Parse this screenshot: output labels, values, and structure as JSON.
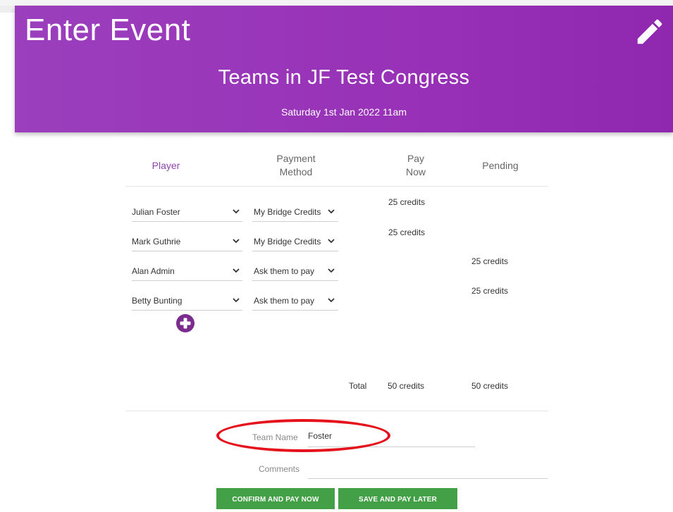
{
  "header": {
    "title": "Enter Event",
    "event_name": "Teams in JF Test Congress",
    "event_date": "Saturday 1st Jan 2022 11am",
    "edit_icon": "pencil-icon"
  },
  "table": {
    "headers": {
      "player": "Player",
      "payment_method_line1": "Payment",
      "payment_method_line2": "Method",
      "pay_now_line1": "Pay",
      "pay_now_line2": "Now",
      "pending": "Pending"
    },
    "rows": [
      {
        "player": "Julian Foster",
        "method": "My Bridge Credits",
        "pay_now": "25 credits",
        "pending": ""
      },
      {
        "player": "Mark Guthrie",
        "method": "My Bridge Credits",
        "pay_now": "25 credits",
        "pending": ""
      },
      {
        "player": "Alan Admin",
        "method": "Ask them to pay",
        "pay_now": "",
        "pending": "25 credits"
      },
      {
        "player": "Betty Bunting",
        "method": "Ask them to pay",
        "pay_now": "",
        "pending": "25 credits"
      }
    ],
    "add_player_icon": "plus-circle-icon",
    "total": {
      "label": "Total",
      "pay_now": "50 credits",
      "pending": "50 credits"
    }
  },
  "form": {
    "team_name_label": "Team Name",
    "team_name_value": "Foster",
    "comments_label": "Comments",
    "comments_value": ""
  },
  "buttons": {
    "confirm": "CONFIRM AND PAY NOW",
    "save_later": "SAVE AND PAY LATER"
  },
  "colors": {
    "header_bg": "#9831b7",
    "accent_purple": "#8e44ad",
    "button_green": "#43a047",
    "highlight_red": "#e5121b"
  }
}
